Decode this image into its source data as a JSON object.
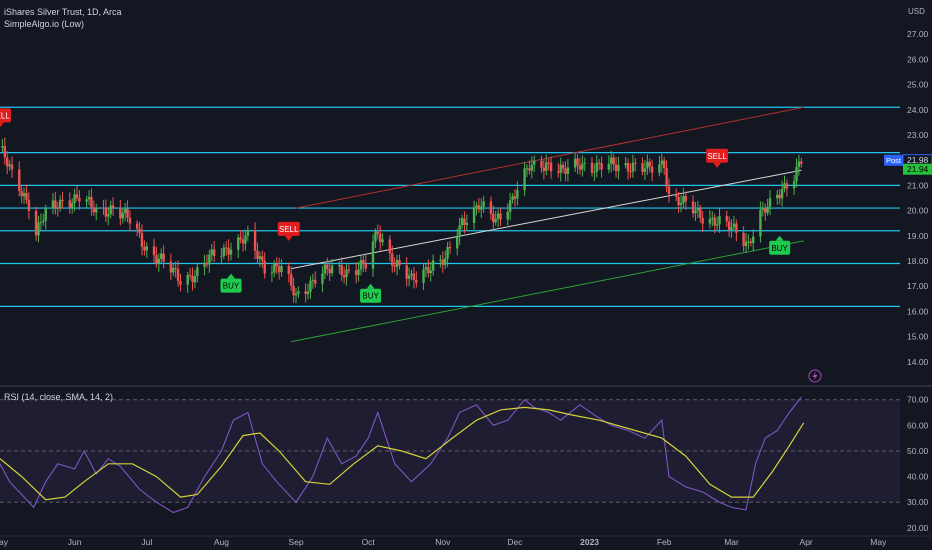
{
  "header": {
    "symbol_line": "iShares Silver Trust, 1D, Arca",
    "indicator_line": "SimpleAlgo.io (Low)",
    "rsi_line": "RSI (14, close, SMA, 14, 2)"
  },
  "currency": "USD",
  "post_label": "Post",
  "colors": {
    "background": "#131722",
    "up": "#26a69a",
    "up_bright": "#4caf50",
    "down": "#ef5350",
    "level_lines": "#22c5ee",
    "sell_badge": "#e11d1d",
    "buy_badge": "#1ecb4f",
    "rsi_line": "#7e57c2",
    "rsi_ma": "#d4d13a",
    "post_badge": "#2962ff",
    "price_badge": "#26c13a"
  },
  "chart_data": [
    {
      "type": "candlestick",
      "title": "iShares Silver Trust, 1D, Arca",
      "y_unit": "USD",
      "ylim": [
        13.2,
        27.8
      ],
      "y_ticks": [
        14,
        15,
        16,
        17,
        18,
        19,
        20,
        21,
        22,
        23,
        24,
        25,
        26,
        27
      ],
      "x_ticks": [
        "May",
        "Jun",
        "Jul",
        "Aug",
        "Sep",
        "Oct",
        "Nov",
        "Dec",
        "2023",
        "Feb",
        "Mar",
        "Apr",
        "May"
      ],
      "x_range": [
        "2022-05-01",
        "2023-05-10"
      ],
      "close_path": [
        [
          "2022-05-01",
          22.5
        ],
        [
          "2022-05-06",
          21.4
        ],
        [
          "2022-05-13",
          20.3
        ],
        [
          "2022-05-16",
          19.1
        ],
        [
          "2022-05-20",
          19.9
        ],
        [
          "2022-05-27",
          20.4
        ],
        [
          "2022-06-03",
          20.5
        ],
        [
          "2022-06-10",
          20.0
        ],
        [
          "2022-06-17",
          20.1
        ],
        [
          "2022-06-24",
          19.6
        ],
        [
          "2022-07-01",
          18.5
        ],
        [
          "2022-07-08",
          17.9
        ],
        [
          "2022-07-15",
          17.3
        ],
        [
          "2022-07-22",
          17.5
        ],
        [
          "2022-07-29",
          18.3
        ],
        [
          "2022-08-05",
          18.6
        ],
        [
          "2022-08-12",
          18.9
        ],
        [
          "2022-08-19",
          17.8
        ],
        [
          "2022-08-26",
          17.7
        ],
        [
          "2022-09-01",
          16.6
        ],
        [
          "2022-09-09",
          17.3
        ],
        [
          "2022-09-16",
          17.7
        ],
        [
          "2022-09-23",
          17.6
        ],
        [
          "2022-09-30",
          17.8
        ],
        [
          "2022-10-05",
          19.2
        ],
        [
          "2022-10-12",
          17.9
        ],
        [
          "2022-10-19",
          17.2
        ],
        [
          "2022-10-26",
          17.8
        ],
        [
          "2022-11-02",
          18.0
        ],
        [
          "2022-11-09",
          19.6
        ],
        [
          "2022-11-16",
          20.2
        ],
        [
          "2022-11-23",
          19.6
        ],
        [
          "2022-11-30",
          20.5
        ],
        [
          "2022-12-07",
          21.7
        ],
        [
          "2022-12-14",
          21.9
        ],
        [
          "2022-12-21",
          21.5
        ],
        [
          "2022-12-28",
          21.9
        ],
        [
          "2023-01-04",
          21.7
        ],
        [
          "2023-01-11",
          21.8
        ],
        [
          "2023-01-18",
          21.8
        ],
        [
          "2023-01-25",
          21.6
        ],
        [
          "2023-02-01",
          21.9
        ],
        [
          "2023-02-03",
          20.6
        ],
        [
          "2023-02-10",
          20.2
        ],
        [
          "2023-02-17",
          19.8
        ],
        [
          "2023-02-24",
          19.5
        ],
        [
          "2023-03-03",
          19.2
        ],
        [
          "2023-03-08",
          18.7
        ],
        [
          "2023-03-13",
          19.8
        ],
        [
          "2023-03-17",
          20.2
        ],
        [
          "2023-03-22",
          20.9
        ],
        [
          "2023-03-27",
          21.4
        ],
        [
          "2023-03-30",
          21.94
        ]
      ],
      "horizontal_levels": [
        24.1,
        22.3,
        21.0,
        20.1,
        19.2,
        17.9,
        16.2
      ],
      "trend_lines": [
        {
          "color": "red",
          "from": [
            "2022-09-01",
            20.1
          ],
          "to": [
            "2023-03-31",
            24.1
          ]
        },
        {
          "color": "white",
          "from": [
            "2022-08-30",
            17.7
          ],
          "to": [
            "2023-03-30",
            21.6
          ]
        },
        {
          "color": "green",
          "from": [
            "2022-08-30",
            14.8
          ],
          "to": [
            "2023-03-31",
            18.8
          ]
        }
      ],
      "signals": [
        {
          "label": "SELL",
          "date": "2022-05-01",
          "price": 23.3
        },
        {
          "label": "BUY",
          "date": "2022-08-05",
          "price": 17.5
        },
        {
          "label": "SELL",
          "date": "2022-08-29",
          "price": 18.8
        },
        {
          "label": "BUY",
          "date": "2022-10-02",
          "price": 17.1
        },
        {
          "label": "SELL",
          "date": "2023-02-23",
          "price": 21.7
        },
        {
          "label": "BUY",
          "date": "2023-03-21",
          "price": 19.0
        }
      ],
      "price_labels": {
        "post": 21.98,
        "last": 21.94
      }
    },
    {
      "type": "line",
      "title": "RSI (14, close, SMA, 14, 2)",
      "ylim": [
        18,
        73
      ],
      "y_ticks": [
        20,
        30,
        40,
        50,
        60,
        70
      ],
      "dashed_levels": [
        70,
        50,
        30
      ],
      "series": [
        {
          "name": "RSI",
          "values": [
            [
              "2022-05-01",
              45
            ],
            [
              "2022-05-05",
              38
            ],
            [
              "2022-05-10",
              33
            ],
            [
              "2022-05-15",
              28
            ],
            [
              "2022-05-20",
              38
            ],
            [
              "2022-05-25",
              45
            ],
            [
              "2022-06-01",
              43
            ],
            [
              "2022-06-05",
              50
            ],
            [
              "2022-06-10",
              41
            ],
            [
              "2022-06-15",
              47
            ],
            [
              "2022-06-20",
              44
            ],
            [
              "2022-06-28",
              35
            ],
            [
              "2022-07-05",
              30
            ],
            [
              "2022-07-12",
              26
            ],
            [
              "2022-07-18",
              28
            ],
            [
              "2022-07-25",
              40
            ],
            [
              "2022-08-01",
              50
            ],
            [
              "2022-08-06",
              62
            ],
            [
              "2022-08-12",
              65
            ],
            [
              "2022-08-18",
              45
            ],
            [
              "2022-08-24",
              38
            ],
            [
              "2022-09-01",
              30
            ],
            [
              "2022-09-08",
              40
            ],
            [
              "2022-09-14",
              55
            ],
            [
              "2022-09-20",
              45
            ],
            [
              "2022-09-26",
              48
            ],
            [
              "2022-10-01",
              55
            ],
            [
              "2022-10-05",
              65
            ],
            [
              "2022-10-12",
              45
            ],
            [
              "2022-10-19",
              38
            ],
            [
              "2022-10-27",
              45
            ],
            [
              "2022-11-03",
              55
            ],
            [
              "2022-11-08",
              65
            ],
            [
              "2022-11-15",
              68
            ],
            [
              "2022-11-22",
              60
            ],
            [
              "2022-11-28",
              62
            ],
            [
              "2022-12-05",
              70
            ],
            [
              "2022-12-09",
              67
            ],
            [
              "2022-12-15",
              65
            ],
            [
              "2022-12-20",
              62
            ],
            [
              "2022-12-28",
              68
            ],
            [
              "2023-01-03",
              64
            ],
            [
              "2023-01-10",
              60
            ],
            [
              "2023-01-17",
              58
            ],
            [
              "2023-01-24",
              55
            ],
            [
              "2023-01-31",
              62
            ],
            [
              "2023-02-03",
              40
            ],
            [
              "2023-02-10",
              36
            ],
            [
              "2023-02-17",
              34
            ],
            [
              "2023-02-24",
              30
            ],
            [
              "2023-03-01",
              28
            ],
            [
              "2023-03-07",
              27
            ],
            [
              "2023-03-11",
              45
            ],
            [
              "2023-03-15",
              55
            ],
            [
              "2023-03-20",
              58
            ],
            [
              "2023-03-25",
              65
            ],
            [
              "2023-03-30",
              71
            ]
          ]
        },
        {
          "name": "RSI-based MA",
          "values": [
            [
              "2022-05-01",
              47
            ],
            [
              "2022-05-10",
              40
            ],
            [
              "2022-05-20",
              31
            ],
            [
              "2022-05-28",
              32
            ],
            [
              "2022-06-05",
              38
            ],
            [
              "2022-06-15",
              45
            ],
            [
              "2022-06-25",
              45
            ],
            [
              "2022-07-05",
              40
            ],
            [
              "2022-07-15",
              32
            ],
            [
              "2022-07-22",
              33
            ],
            [
              "2022-08-01",
              44
            ],
            [
              "2022-08-10",
              56
            ],
            [
              "2022-08-17",
              57
            ],
            [
              "2022-08-25",
              50
            ],
            [
              "2022-09-05",
              38
            ],
            [
              "2022-09-15",
              37
            ],
            [
              "2022-09-25",
              45
            ],
            [
              "2022-10-05",
              52
            ],
            [
              "2022-10-15",
              50
            ],
            [
              "2022-10-25",
              47
            ],
            [
              "2022-11-05",
              55
            ],
            [
              "2022-11-15",
              62
            ],
            [
              "2022-11-25",
              66
            ],
            [
              "2022-12-05",
              67
            ],
            [
              "2022-12-15",
              66
            ],
            [
              "2022-12-25",
              64
            ],
            [
              "2023-01-05",
              62
            ],
            [
              "2023-01-20",
              58
            ],
            [
              "2023-01-31",
              55
            ],
            [
              "2023-02-10",
              48
            ],
            [
              "2023-02-20",
              37
            ],
            [
              "2023-03-01",
              32
            ],
            [
              "2023-03-10",
              32
            ],
            [
              "2023-03-18",
              42
            ],
            [
              "2023-03-25",
              52
            ],
            [
              "2023-03-31",
              61
            ]
          ]
        }
      ]
    }
  ]
}
